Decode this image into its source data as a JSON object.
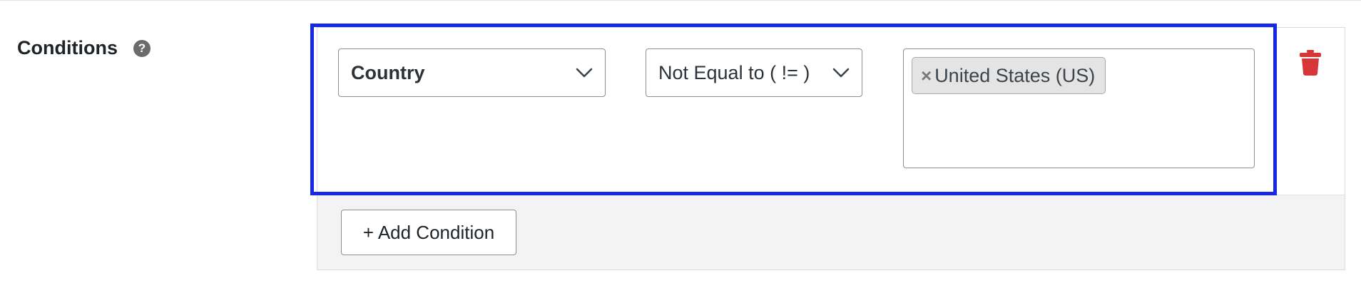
{
  "section": {
    "label": "Conditions",
    "help_icon": "question-circle-icon",
    "help_glyph": "?"
  },
  "condition": {
    "field": {
      "selected": "Country",
      "icon": "chevron-down-icon"
    },
    "operator": {
      "selected": "Not Equal to ( != )",
      "icon": "chevron-down-icon"
    },
    "values": [
      {
        "remove_glyph": "×",
        "label": "United States (US)"
      }
    ],
    "delete_icon": "trash-icon",
    "delete_color": "#d63638"
  },
  "actions": {
    "add_label": "+ Add Condition"
  },
  "colors": {
    "highlight": "#1428e6",
    "footer_bg": "#f3f3f3",
    "token_bg": "#e4e4e4"
  }
}
